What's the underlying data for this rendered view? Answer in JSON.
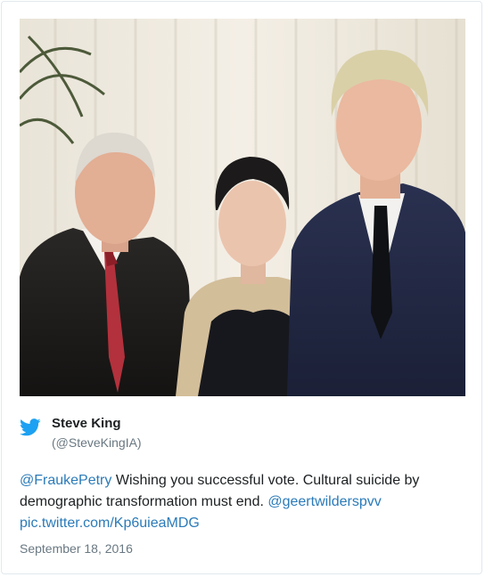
{
  "tweet": {
    "author_name": "Steve King",
    "author_handle": "(@SteveKingIA)",
    "mention_1": "@FraukePetry",
    "text_1": " Wishing you successful vote. Cultural suicide by demographic transformation must end. ",
    "mention_2": "@geertwilderspvv",
    "link": "pic.twitter.com/Kp6uieaMDG",
    "date": "September 18, 2016",
    "icon": "twitter-bird-icon",
    "colors": {
      "brand": "#1da1f2",
      "link": "#2b7bb9",
      "muted": "#697882",
      "text": "#1c2022",
      "border": "#e1e8ed"
    }
  }
}
